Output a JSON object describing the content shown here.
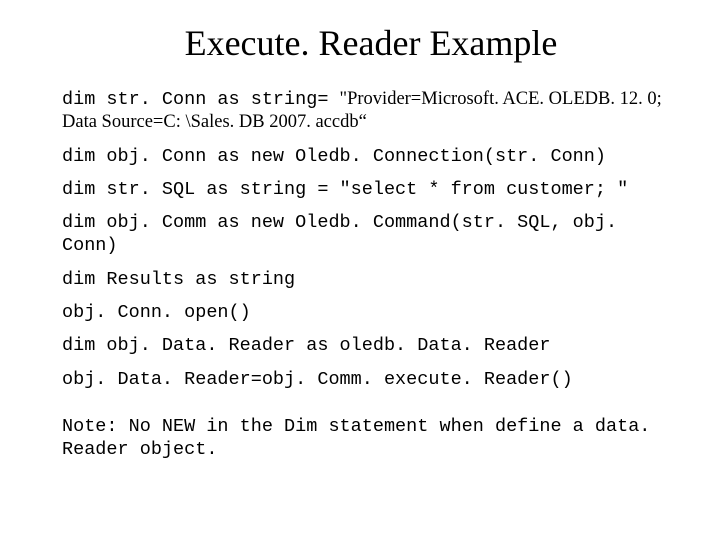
{
  "title": "Execute. Reader Example",
  "lines": {
    "l1a": "dim str. Conn as string= ",
    "l1b": "\"Provider=Microsoft. ACE. OLEDB. 12. 0; Data Source=C: \\Sales. DB 2007. accdb“",
    "l2": "dim obj. Conn as new Oledb. Connection(str. Conn)",
    "l3": "dim str. SQL as string = \"select * from customer; \"",
    "l4": "dim obj. Comm as new Oledb. Command(str. SQL, obj. Conn)",
    "l5": "dim Results as string",
    "l6": "obj. Conn. open()",
    "l7": "dim obj. Data. Reader as oledb. Data. Reader",
    "l8": "obj. Data. Reader=obj. Comm. execute. Reader()",
    "note": "Note: No NEW in the Dim statement when define a data. Reader object."
  }
}
